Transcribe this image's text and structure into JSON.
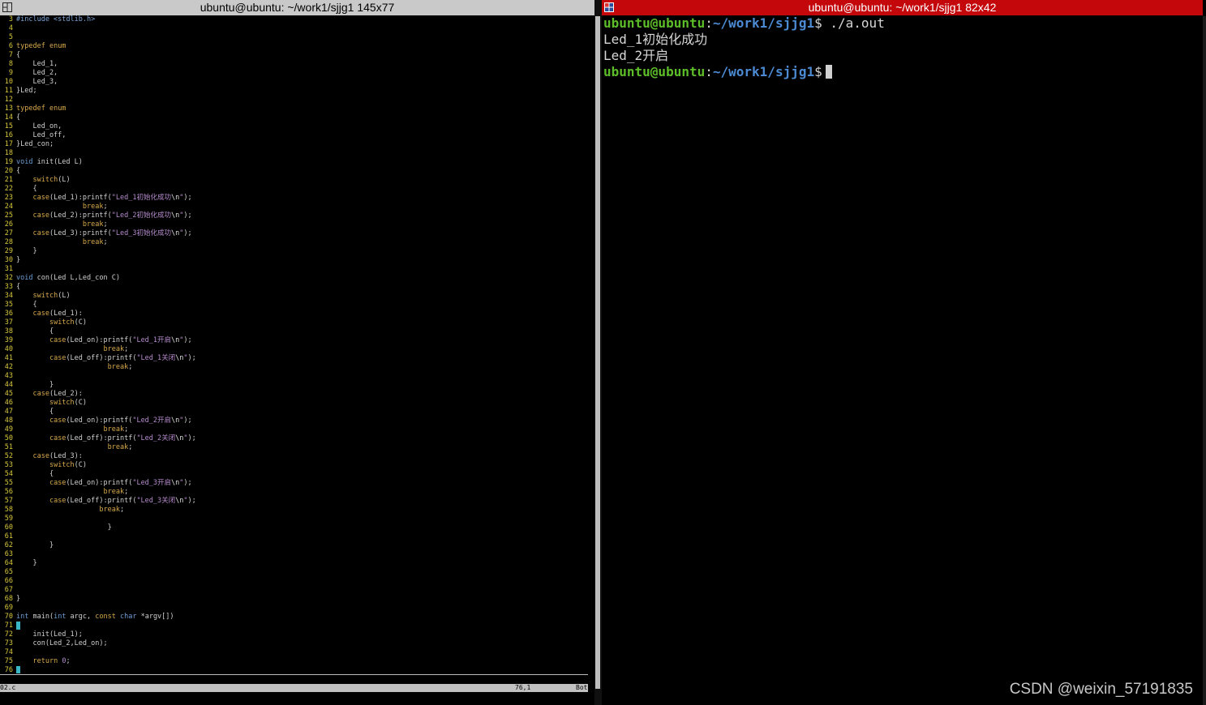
{
  "left_window": {
    "title": "ubuntu@ubuntu: ~/work1/sjjg1 145x77",
    "icon": "split-window-icon"
  },
  "right_window": {
    "title": "ubuntu@ubuntu: ~/work1/sjjg1 82x42",
    "icon": "split-window-icon"
  },
  "editor": {
    "lines": [
      {
        "n": "3",
        "c": "#include <stdlib.h>"
      },
      {
        "n": "4",
        "c": ""
      },
      {
        "n": "5",
        "c": ""
      },
      {
        "n": "6",
        "c": "typedef enum"
      },
      {
        "n": "7",
        "c": "{"
      },
      {
        "n": "8",
        "c": "    Led_1,"
      },
      {
        "n": "9",
        "c": "    Led_2,"
      },
      {
        "n": "10",
        "c": "    Led_3,"
      },
      {
        "n": "11",
        "c": "}Led;"
      },
      {
        "n": "12",
        "c": ""
      },
      {
        "n": "13",
        "c": "typedef enum"
      },
      {
        "n": "14",
        "c": "{"
      },
      {
        "n": "15",
        "c": "    Led_on,"
      },
      {
        "n": "16",
        "c": "    Led_off,"
      },
      {
        "n": "17",
        "c": "}Led_con;"
      },
      {
        "n": "18",
        "c": ""
      },
      {
        "n": "19",
        "c": "void init(Led L)"
      },
      {
        "n": "20",
        "c": "{"
      },
      {
        "n": "21",
        "c": "    switch(L)"
      },
      {
        "n": "22",
        "c": "    {"
      },
      {
        "n": "23",
        "c": "    case(Led_1):printf(\"Led_1初始化成功\\n\");"
      },
      {
        "n": "24",
        "c": "                break;"
      },
      {
        "n": "25",
        "c": "    case(Led_2):printf(\"Led_2初始化成功\\n\");"
      },
      {
        "n": "26",
        "c": "                break;"
      },
      {
        "n": "27",
        "c": "    case(Led_3):printf(\"Led_3初始化成功\\n\");"
      },
      {
        "n": "28",
        "c": "                break;"
      },
      {
        "n": "29",
        "c": "    }"
      },
      {
        "n": "30",
        "c": "}"
      },
      {
        "n": "31",
        "c": ""
      },
      {
        "n": "32",
        "c": "void con(Led L,Led_con C)"
      },
      {
        "n": "33",
        "c": "{"
      },
      {
        "n": "34",
        "c": "    switch(L)"
      },
      {
        "n": "35",
        "c": "    {"
      },
      {
        "n": "36",
        "c": "    case(Led_1):"
      },
      {
        "n": "37",
        "c": "        switch(C)"
      },
      {
        "n": "38",
        "c": "        {"
      },
      {
        "n": "39",
        "c": "        case(Led_on):printf(\"Led_1开启\\n\");"
      },
      {
        "n": "40",
        "c": "                     break;"
      },
      {
        "n": "41",
        "c": "        case(Led_off):printf(\"Led_1关闭\\n\");"
      },
      {
        "n": "42",
        "c": "                      break;"
      },
      {
        "n": "43",
        "c": ""
      },
      {
        "n": "44",
        "c": "        }"
      },
      {
        "n": "45",
        "c": "    case(Led_2):"
      },
      {
        "n": "46",
        "c": "        switch(C)"
      },
      {
        "n": "47",
        "c": "        {"
      },
      {
        "n": "48",
        "c": "        case(Led_on):printf(\"Led_2开启\\n\");"
      },
      {
        "n": "49",
        "c": "                     break;"
      },
      {
        "n": "50",
        "c": "        case(Led_off):printf(\"Led_2关闭\\n\");"
      },
      {
        "n": "51",
        "c": "                      break;"
      },
      {
        "n": "52",
        "c": "    case(Led_3):"
      },
      {
        "n": "53",
        "c": "        switch(C)"
      },
      {
        "n": "54",
        "c": "        {"
      },
      {
        "n": "55",
        "c": "        case(Led_on):printf(\"Led_3开启\\n\");"
      },
      {
        "n": "56",
        "c": "                     break;"
      },
      {
        "n": "57",
        "c": "        case(Led_off):printf(\"Led_3关闭\\n\");"
      },
      {
        "n": "58",
        "c": "                    break;"
      },
      {
        "n": "59",
        "c": ""
      },
      {
        "n": "60",
        "c": "                      }"
      },
      {
        "n": "61",
        "c": ""
      },
      {
        "n": "62",
        "c": "        }"
      },
      {
        "n": "63",
        "c": ""
      },
      {
        "n": "64",
        "c": "    }"
      },
      {
        "n": "65",
        "c": ""
      },
      {
        "n": "66",
        "c": ""
      },
      {
        "n": "67",
        "c": ""
      },
      {
        "n": "68",
        "c": "}"
      },
      {
        "n": "69",
        "c": ""
      },
      {
        "n": "70",
        "c": "int main(int argc, const char *argv[])"
      },
      {
        "n": "71",
        "c": "{",
        "cursor": true
      },
      {
        "n": "72",
        "c": "    init(Led_1);"
      },
      {
        "n": "73",
        "c": "    con(Led_2,Led_on);"
      },
      {
        "n": "74",
        "c": ""
      },
      {
        "n": "75",
        "c": "    return 0;"
      },
      {
        "n": "76",
        "c": "}",
        "cursor": true
      }
    ],
    "status": {
      "file": "02.c",
      "position": "76,1",
      "scroll": "Bot"
    }
  },
  "terminal": {
    "user_host": "ubuntu@ubuntu",
    "path": "~/work1/sjjg1",
    "prompt_symbol": "$",
    "command": "./a.out",
    "output": [
      "Led_1初始化成功",
      "Led_2开启"
    ]
  },
  "watermark": "CSDN @weixin_57191835",
  "colors": {
    "right_titlebar": "#c3070b",
    "prompt_user": "#5dbd29",
    "prompt_path": "#4c8bd4"
  }
}
